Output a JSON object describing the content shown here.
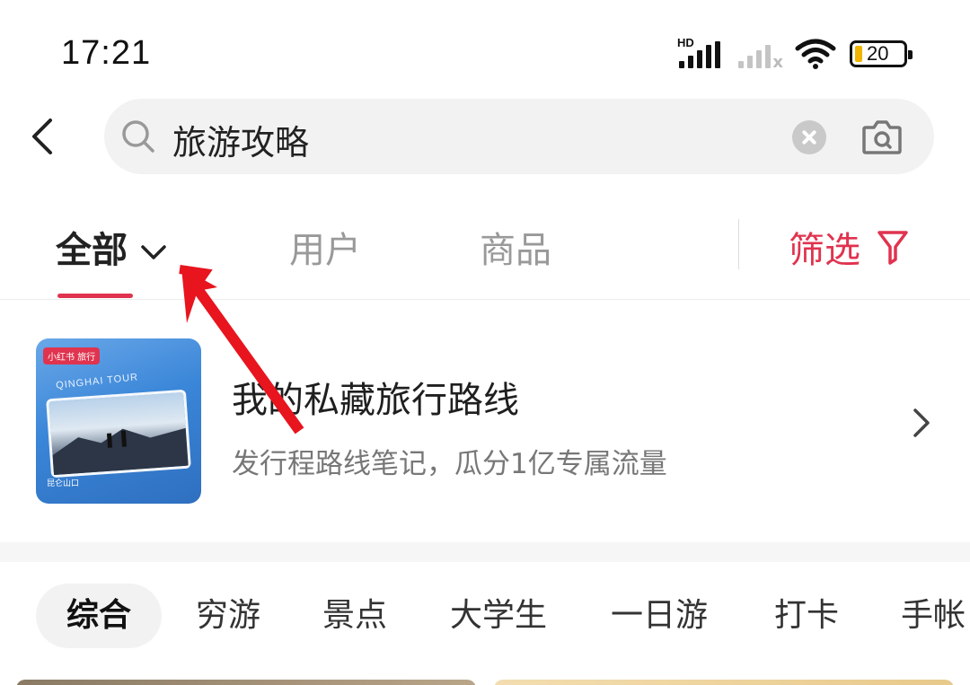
{
  "status_bar": {
    "time": "17:21",
    "signal1_label": "HD",
    "battery_level": "20"
  },
  "search": {
    "query": "旅游攻略"
  },
  "tabs": {
    "all": "全部",
    "users": "用户",
    "goods": "商品",
    "filter": "筛选"
  },
  "banner": {
    "title": "我的私藏旅行路线",
    "subtitle": "发行程路线笔记，瓜分1亿专属流量",
    "thumb_badge": "小红书 旅行",
    "thumb_tour": "QINGHAI TOUR",
    "thumb_place": "昆仑山口"
  },
  "chips": [
    "综合",
    "穷游",
    "景点",
    "大学生",
    "一日游",
    "打卡",
    "手帐"
  ],
  "colors": {
    "accent": "#e0334f",
    "annotation": "#e8141e"
  }
}
